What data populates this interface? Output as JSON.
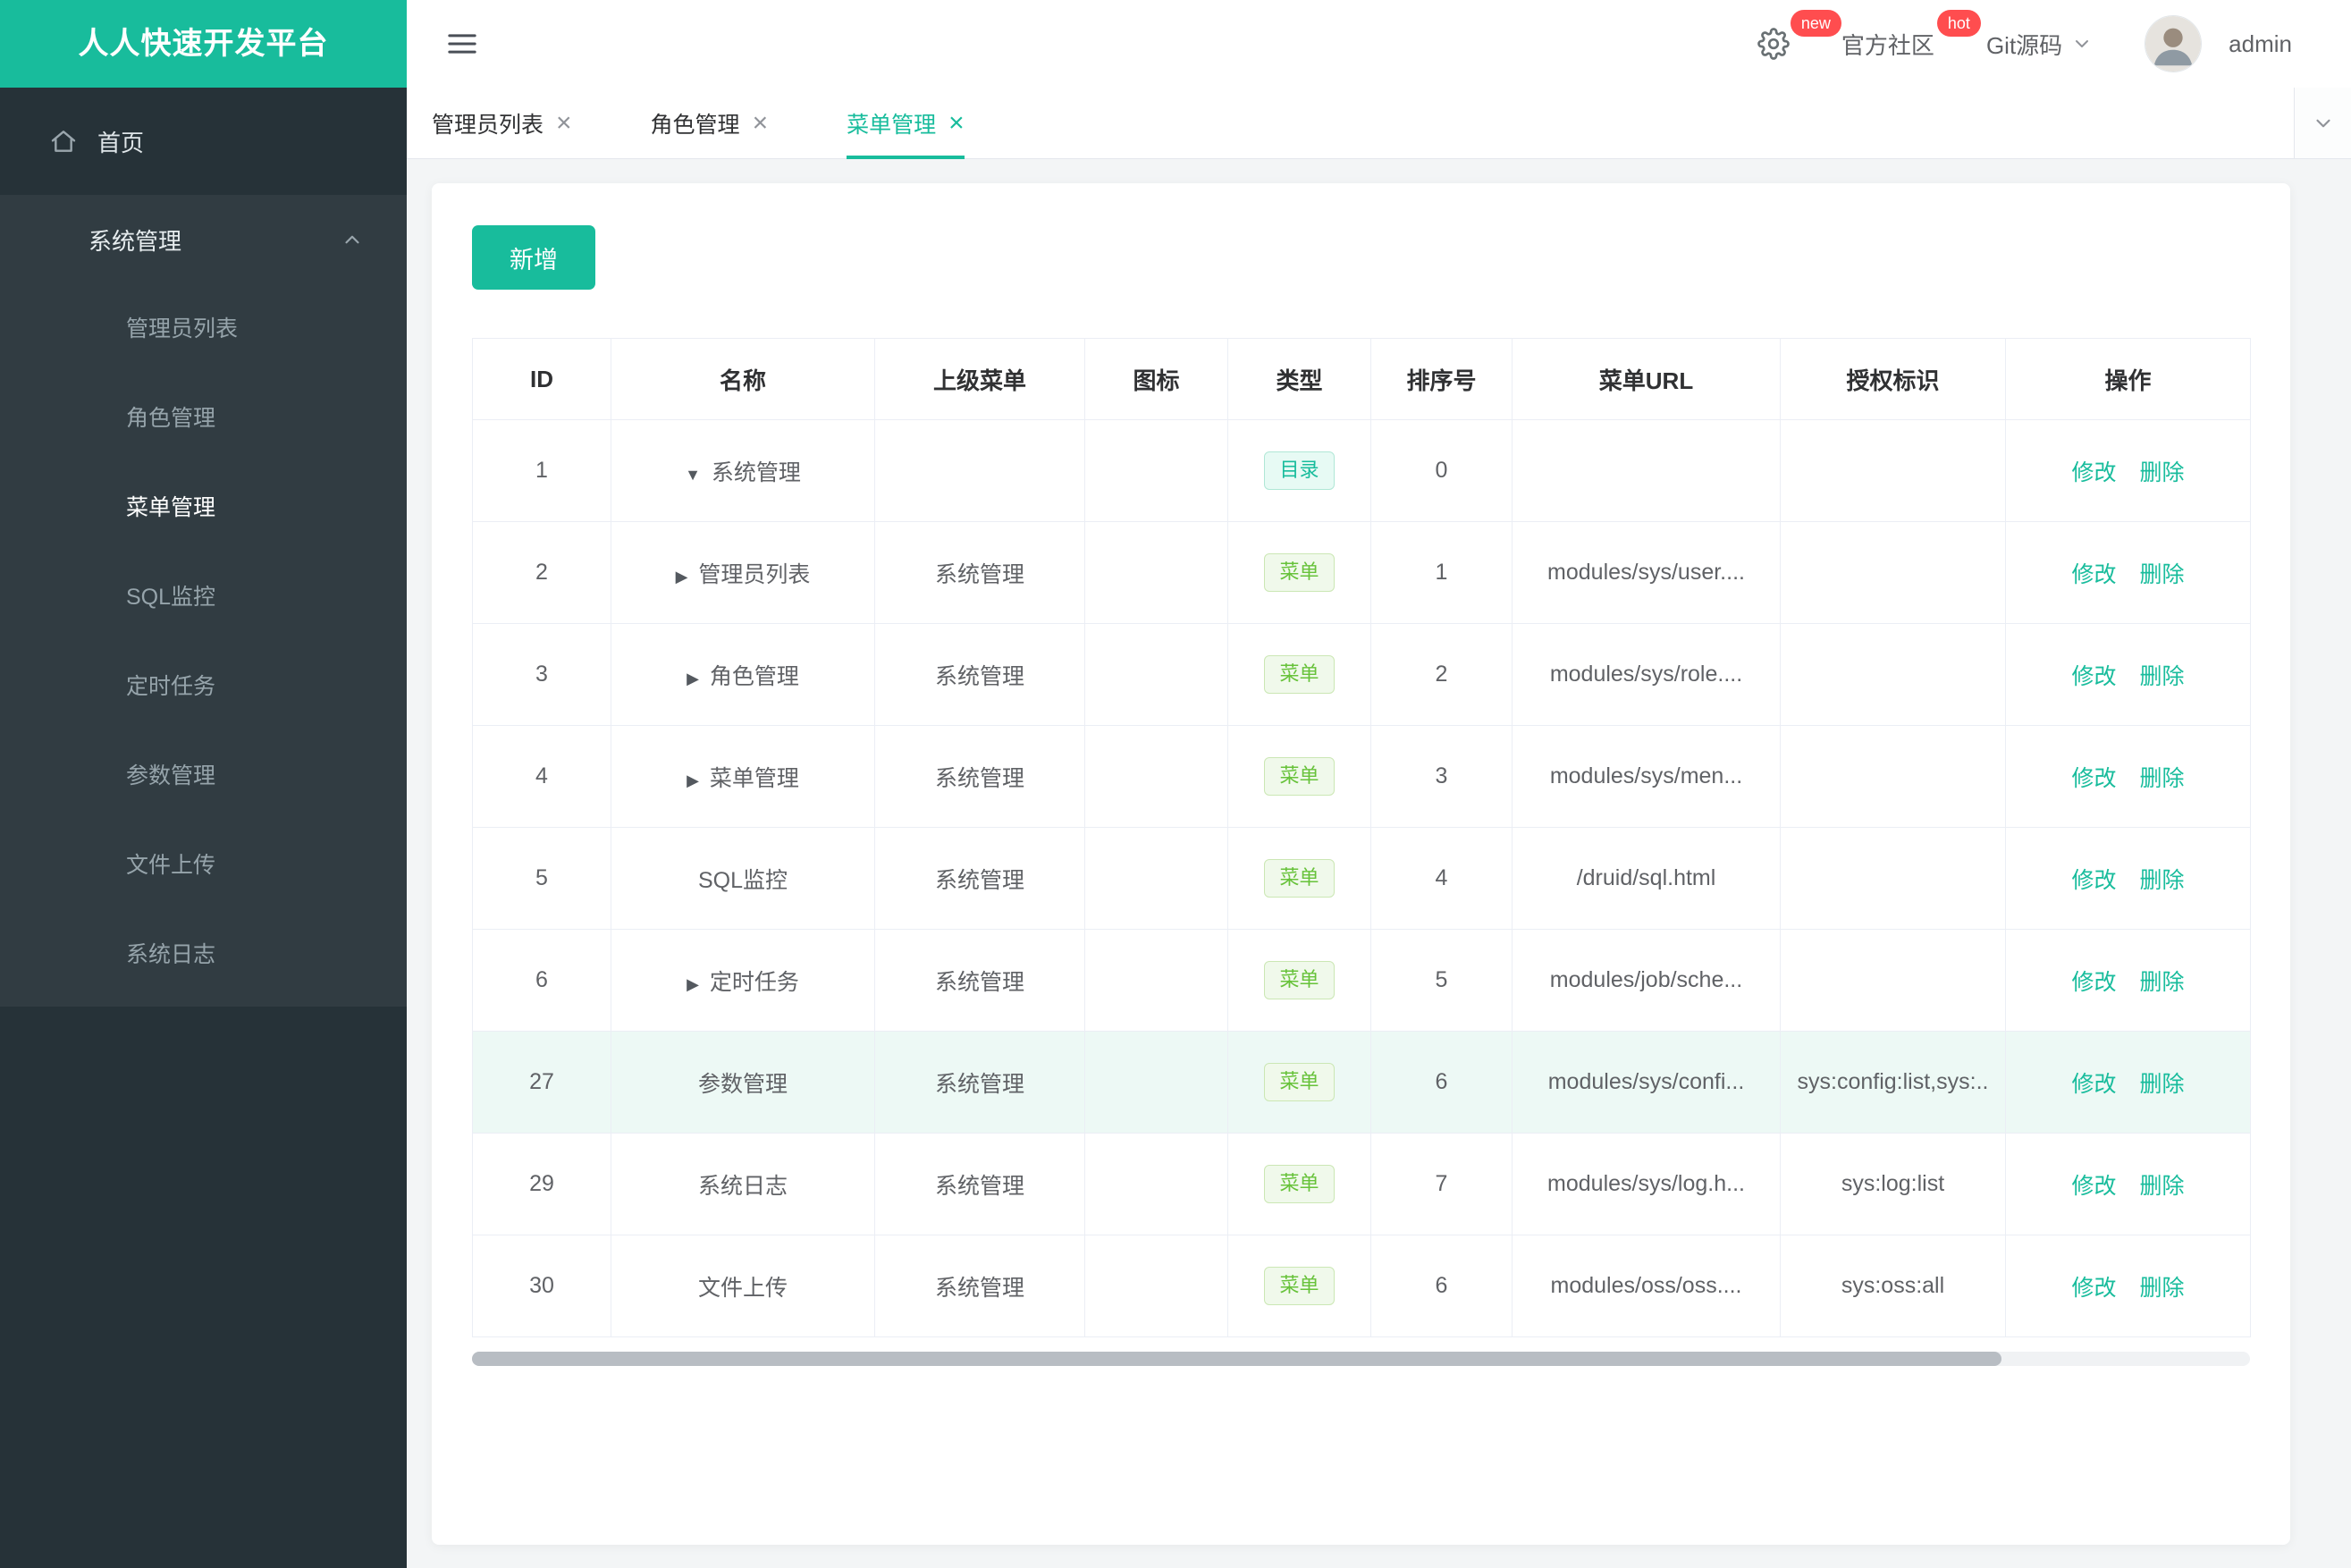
{
  "colors": {
    "accent": "#18bc9c",
    "badge": "#ff4d4f",
    "sidebar": "#263238",
    "success": "#67c23a"
  },
  "brand": {
    "title": "人人快速开发平台"
  },
  "sidebar": {
    "home_label": "首页",
    "group_label": "系统管理",
    "items": [
      {
        "key": "admin-list",
        "label": "管理员列表",
        "active": false
      },
      {
        "key": "role-mgmt",
        "label": "角色管理",
        "active": false
      },
      {
        "key": "menu-mgmt",
        "label": "菜单管理",
        "active": true
      },
      {
        "key": "sql-monitor",
        "label": "SQL监控",
        "active": false
      },
      {
        "key": "cron-jobs",
        "label": "定时任务",
        "active": false
      },
      {
        "key": "param-mgmt",
        "label": "参数管理",
        "active": false
      },
      {
        "key": "file-upload",
        "label": "文件上传",
        "active": false
      },
      {
        "key": "system-log",
        "label": "系统日志",
        "active": false
      }
    ]
  },
  "header": {
    "new_badge": "new",
    "hot_badge": "hot",
    "community_label": "官方社区",
    "git_label": "Git源码",
    "username": "admin"
  },
  "tabs": [
    {
      "key": "admin-list",
      "label": "管理员列表",
      "active": false
    },
    {
      "key": "role-mgmt",
      "label": "角色管理",
      "active": false
    },
    {
      "key": "menu-mgmt",
      "label": "菜单管理",
      "active": true
    }
  ],
  "toolbar": {
    "add_label": "新增"
  },
  "icons": {
    "tab_close": "×",
    "collapse": "▼",
    "expand": "▶"
  },
  "table": {
    "headers": [
      "ID",
      "名称",
      "上级菜单",
      "图标",
      "类型",
      "排序号",
      "菜单URL",
      "授权标识",
      "操作"
    ],
    "edit_label": "修改",
    "delete_label": "删除",
    "rows": [
      {
        "id": "1",
        "expander": "down",
        "name": "系统管理",
        "parent": "",
        "icon": "",
        "type": "目录",
        "type_kind": "dir",
        "sort": "0",
        "url": "",
        "perms": "",
        "highlight": false
      },
      {
        "id": "2",
        "expander": "right",
        "name": "管理员列表",
        "parent": "系统管理",
        "icon": "",
        "type": "菜单",
        "type_kind": "menu",
        "sort": "1",
        "url": "modules/sys/user....",
        "perms": "",
        "highlight": false
      },
      {
        "id": "3",
        "expander": "right",
        "name": "角色管理",
        "parent": "系统管理",
        "icon": "",
        "type": "菜单",
        "type_kind": "menu",
        "sort": "2",
        "url": "modules/sys/role....",
        "perms": "",
        "highlight": false
      },
      {
        "id": "4",
        "expander": "right",
        "name": "菜单管理",
        "parent": "系统管理",
        "icon": "",
        "type": "菜单",
        "type_kind": "menu",
        "sort": "3",
        "url": "modules/sys/men...",
        "perms": "",
        "highlight": false
      },
      {
        "id": "5",
        "expander": "none",
        "name": "SQL监控",
        "parent": "系统管理",
        "icon": "",
        "type": "菜单",
        "type_kind": "menu",
        "sort": "4",
        "url": "/druid/sql.html",
        "perms": "",
        "highlight": false
      },
      {
        "id": "6",
        "expander": "right",
        "name": "定时任务",
        "parent": "系统管理",
        "icon": "",
        "type": "菜单",
        "type_kind": "menu",
        "sort": "5",
        "url": "modules/job/sche...",
        "perms": "",
        "highlight": false
      },
      {
        "id": "27",
        "expander": "none",
        "name": "参数管理",
        "parent": "系统管理",
        "icon": "",
        "type": "菜单",
        "type_kind": "menu",
        "sort": "6",
        "url": "modules/sys/confi...",
        "perms": "sys:config:list,sys:..",
        "highlight": true
      },
      {
        "id": "29",
        "expander": "none",
        "name": "系统日志",
        "parent": "系统管理",
        "icon": "",
        "type": "菜单",
        "type_kind": "menu",
        "sort": "7",
        "url": "modules/sys/log.h...",
        "perms": "sys:log:list",
        "highlight": false
      },
      {
        "id": "30",
        "expander": "none",
        "name": "文件上传",
        "parent": "系统管理",
        "icon": "",
        "type": "菜单",
        "type_kind": "menu",
        "sort": "6",
        "url": "modules/oss/oss....",
        "perms": "sys:oss:all",
        "highlight": false
      }
    ]
  }
}
